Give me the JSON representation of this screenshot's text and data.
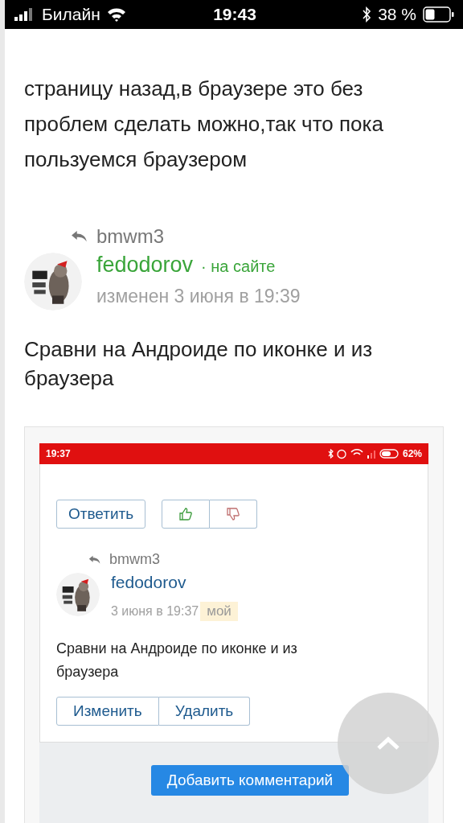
{
  "status_bar": {
    "carrier": "Билайн",
    "time": "19:43",
    "battery": "38 %"
  },
  "post": {
    "text": "страницу назад,в браузере это без проблем сделать можно,так что пока пользуемся браузером"
  },
  "comment": {
    "reply_to": "bmwm3",
    "author": "fedodorov",
    "presence": "· на сайте",
    "date": "изменен 3 июня в 19:39",
    "text": "Сравни на Андроиде по иконке и из браузера"
  },
  "screenshot": {
    "status_bar": {
      "time": "19:37",
      "battery": "62%"
    },
    "reply_button": "Ответить",
    "comment": {
      "reply_to": "bmwm3",
      "author": "fedodorov",
      "date": "3 июня в 19:37",
      "badge": "мой",
      "text": "Сравни на Андроиде по иконке и из браузера"
    },
    "buttons": [
      "Изменить",
      "Удалить"
    ],
    "add_comment": "Добавить комментарий"
  }
}
